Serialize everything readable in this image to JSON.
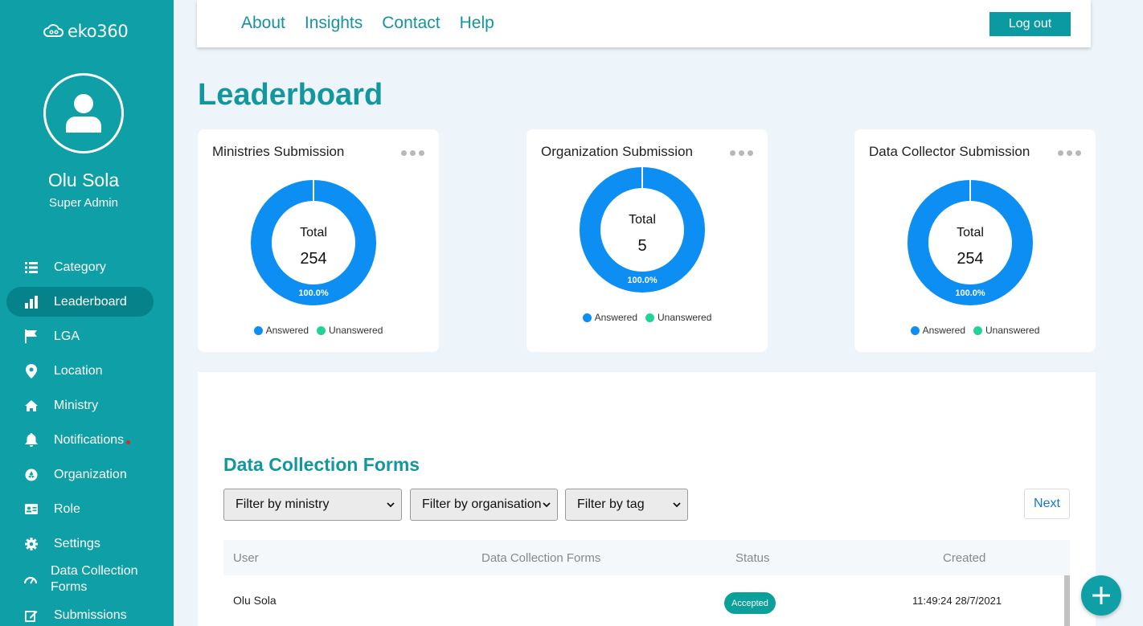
{
  "app": {
    "logo_text": "eko360"
  },
  "user": {
    "name": "Olu Sola",
    "role": "Super Admin"
  },
  "sidebar": {
    "items": [
      {
        "label": "Category",
        "icon": "list-icon"
      },
      {
        "label": "Leaderboard",
        "icon": "leaderboard-icon",
        "active": true
      },
      {
        "label": "LGA",
        "icon": "flag-icon"
      },
      {
        "label": "Location",
        "icon": "map-pin-icon"
      },
      {
        "label": "Ministry",
        "icon": "home-icon"
      },
      {
        "label": "Notifications",
        "icon": "bell-icon",
        "has_dot": true
      },
      {
        "label": "Organization",
        "icon": "aperture-icon"
      },
      {
        "label": "Role",
        "icon": "id-card-icon"
      },
      {
        "label": "Settings",
        "icon": "gear-icon"
      },
      {
        "label": "Data Collection Forms",
        "icon": "gauge-icon"
      },
      {
        "label": "Submissions",
        "icon": "edit-icon"
      }
    ]
  },
  "topnav": {
    "links": [
      "About",
      "Insights",
      "Contact",
      "Help"
    ],
    "logout_label": "Log out"
  },
  "page": {
    "title": "Leaderboard"
  },
  "cards": [
    {
      "title": "Ministries Submission",
      "total_label": "Total",
      "total_value": "254",
      "percent_label": "100.0%"
    },
    {
      "title": "Organization Submission",
      "total_label": "Total",
      "total_value": "5",
      "percent_label": "100.0%"
    },
    {
      "title": "Data Collector Submission",
      "total_label": "Total",
      "total_value": "254",
      "percent_label": "100.0%"
    }
  ],
  "legend": {
    "answered": "Answered",
    "unanswered": "Unanswered"
  },
  "colors": {
    "answered": "#0c8ef2",
    "unanswered": "#21d496",
    "accent": "#0ea0a6"
  },
  "chart_data": [
    {
      "type": "pie",
      "title": "Ministries Submission",
      "categories": [
        "Answered",
        "Unanswered"
      ],
      "values": [
        100,
        0
      ]
    },
    {
      "type": "pie",
      "title": "Organization Submission",
      "categories": [
        "Answered",
        "Unanswered"
      ],
      "values": [
        100,
        0
      ]
    },
    {
      "type": "pie",
      "title": "Data Collector Submission",
      "categories": [
        "Answered",
        "Unanswered"
      ],
      "values": [
        100,
        0
      ]
    }
  ],
  "forms": {
    "title": "Data Collection Forms",
    "filters": [
      "Filter by ministry",
      "Filter by organisation",
      "Filter by tag"
    ],
    "next_label": "Next",
    "columns": [
      "User",
      "Data Collection Forms",
      "Status",
      "Created"
    ],
    "rows": [
      {
        "user": "Olu Sola",
        "form": "",
        "status": "Accepted",
        "created": "11:49:24 28/7/2021"
      }
    ]
  },
  "fab": {
    "icon": "plus-icon"
  }
}
